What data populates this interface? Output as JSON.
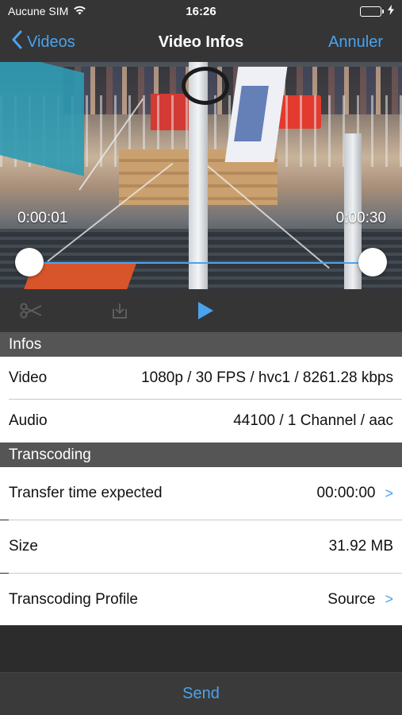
{
  "status_bar": {
    "carrier": "Aucune SIM",
    "time": "16:26",
    "icons": [
      "wifi-icon",
      "battery-icon",
      "charging-bolt-icon"
    ],
    "battery_color": "#4cd964"
  },
  "nav": {
    "back_label": "Videos",
    "title": "Video Infos",
    "cancel_label": "Annuler",
    "accent_color": "#4aa3f0"
  },
  "player": {
    "start_time": "0:00:01",
    "end_time": "0:00:30"
  },
  "toolbar": {
    "tools": [
      "scissors-icon",
      "export-icon",
      "play-icon"
    ]
  },
  "infos": {
    "header": "Infos",
    "video_label": "Video",
    "video_value": "1080p / 30 FPS / hvc1 / 8261.28 kbps",
    "audio_label": "Audio",
    "audio_value": "44100 / 1 Channel / aac"
  },
  "transcoding": {
    "header": "Transcoding",
    "transfer_label": "Transfer time expected",
    "transfer_value": "00:00:00",
    "size_label": "Size",
    "size_value": "31.92 MB",
    "profile_label": "Transcoding Profile",
    "profile_value": "Source",
    "chevron": ">"
  },
  "footer": {
    "send_label": "Send"
  }
}
